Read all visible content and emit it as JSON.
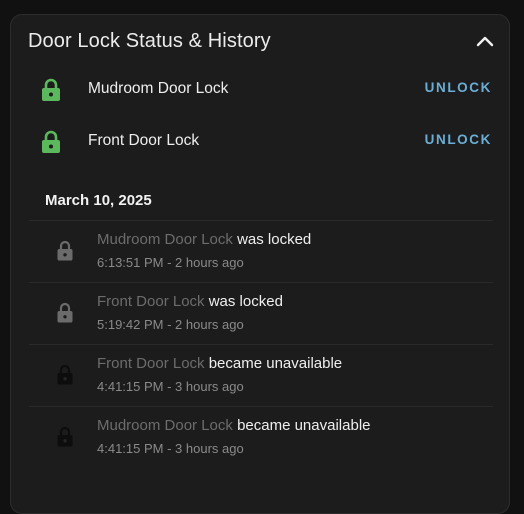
{
  "card": {
    "title": "Door Lock Status & History",
    "collapse_icon": "chevron-up-icon"
  },
  "locks": [
    {
      "name": "Mudroom Door Lock",
      "action": "UNLOCK",
      "icon": "lock-icon",
      "state_color": "#5cb85c"
    },
    {
      "name": "Front Door Lock",
      "action": "UNLOCK",
      "icon": "lock-icon",
      "state_color": "#5cb85c"
    }
  ],
  "history": {
    "date": "March 10, 2025",
    "items": [
      {
        "entity": "Mudroom Door Lock",
        "message": "was locked",
        "time": "6:13:51 PM - 2 hours ago",
        "icon": "lock-icon",
        "icon_color": "#6b6b6b"
      },
      {
        "entity": "Front Door Lock",
        "message": "was locked",
        "time": "5:19:42 PM - 2 hours ago",
        "icon": "lock-icon",
        "icon_color": "#6b6b6b"
      },
      {
        "entity": "Front Door Lock",
        "message": "became unavailable",
        "time": "4:41:15 PM - 3 hours ago",
        "icon": "lock-icon",
        "icon_color": "#0d0d0d"
      },
      {
        "entity": "Mudroom Door Lock",
        "message": "became unavailable",
        "time": "4:41:15 PM - 3 hours ago",
        "icon": "lock-icon",
        "icon_color": "#0d0d0d"
      }
    ]
  }
}
